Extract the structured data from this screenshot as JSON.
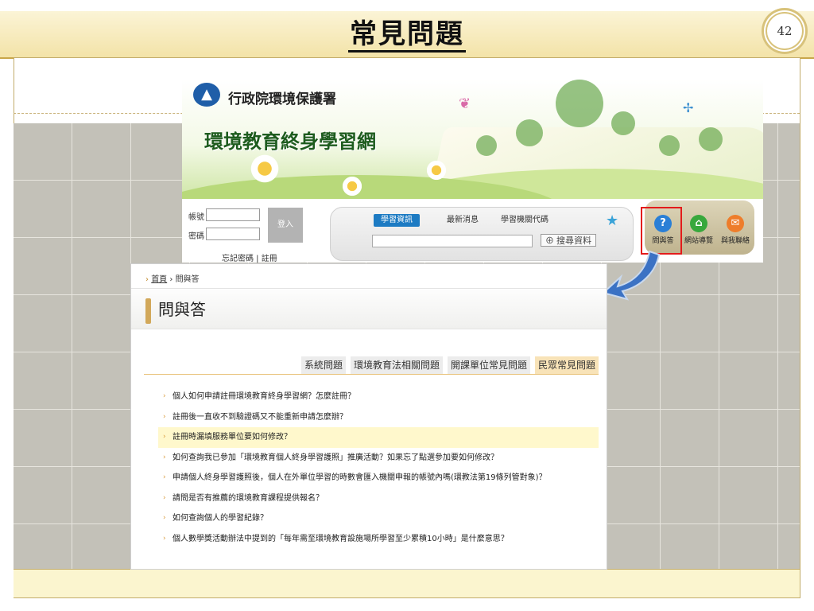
{
  "slide": {
    "title": "常見問題",
    "page_number": "42"
  },
  "site_header": {
    "org_name": "行政院環境保護署",
    "site_name": "環境教育終身學習網"
  },
  "login": {
    "account_label": "帳號",
    "password_label": "密碼",
    "login_button": "登入",
    "forgot_link": "忘記密碼 | 註冊"
  },
  "search": {
    "tabs": [
      "學習資訊",
      "最新消息",
      "學習機關代碼"
    ],
    "button": "搜尋資料"
  },
  "icon_nav": [
    {
      "label": "問與答",
      "icon": "question-icon",
      "color": "#2a7fd6"
    },
    {
      "label": "網站導覽",
      "icon": "home-icon",
      "color": "#38a83c"
    },
    {
      "label": "與我聯絡",
      "icon": "mail-icon",
      "color": "#ee7d2b"
    }
  ],
  "qa_page": {
    "breadcrumb_home": "首頁",
    "breadcrumb_current": "問與答",
    "title": "問與答",
    "tabs": [
      "系統問題",
      "環境教育法相關問題",
      "開課單位常見問題",
      "民眾常見問題"
    ],
    "active_tab": 3,
    "questions": [
      "個人如何申請註冊環境教育終身學習網？怎麼註冊？",
      "註冊後一直收不到驗證碼又不能重新申請怎麼辦？",
      "註冊時漏填服務單位要如何修改？",
      "如何查詢我已參加「環境教育個人終身學習護照」推廣活動？如果忘了點選參加要如何修改？",
      "申請個人終身學習護照後，個人在外單位學習的時數會匯入機關申報的帳號內嗎(環教法第19條列管對象)？",
      "請問是否有推薦的環境教育課程提供報名？",
      "如何查詢個人的學習紀錄？",
      "個人數學獎活動辦法中提到的「每年需至環境教育設施場所學習至少累積10小時」是什麼意思？"
    ],
    "selected_question": 2
  }
}
